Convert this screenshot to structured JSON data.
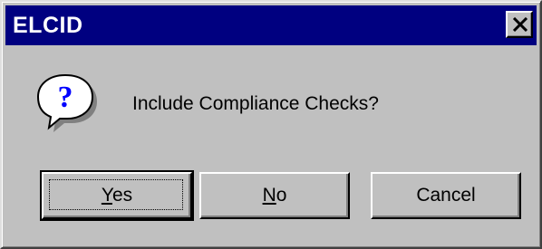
{
  "window": {
    "title": "ELCID",
    "close_icon": "close-x-icon"
  },
  "dialog": {
    "icon": "question-balloon-icon",
    "icon_glyph": "?",
    "message": "Include Compliance Checks?"
  },
  "buttons": {
    "yes": {
      "mnemonic": "Y",
      "rest": "es"
    },
    "no": {
      "mnemonic": "N",
      "rest": "o"
    },
    "cancel": {
      "label": "Cancel"
    }
  },
  "colors": {
    "title_bar": "#000080",
    "face": "#c0c0c0",
    "icon_fill": "#ffffff",
    "icon_glyph": "#0000ff"
  }
}
